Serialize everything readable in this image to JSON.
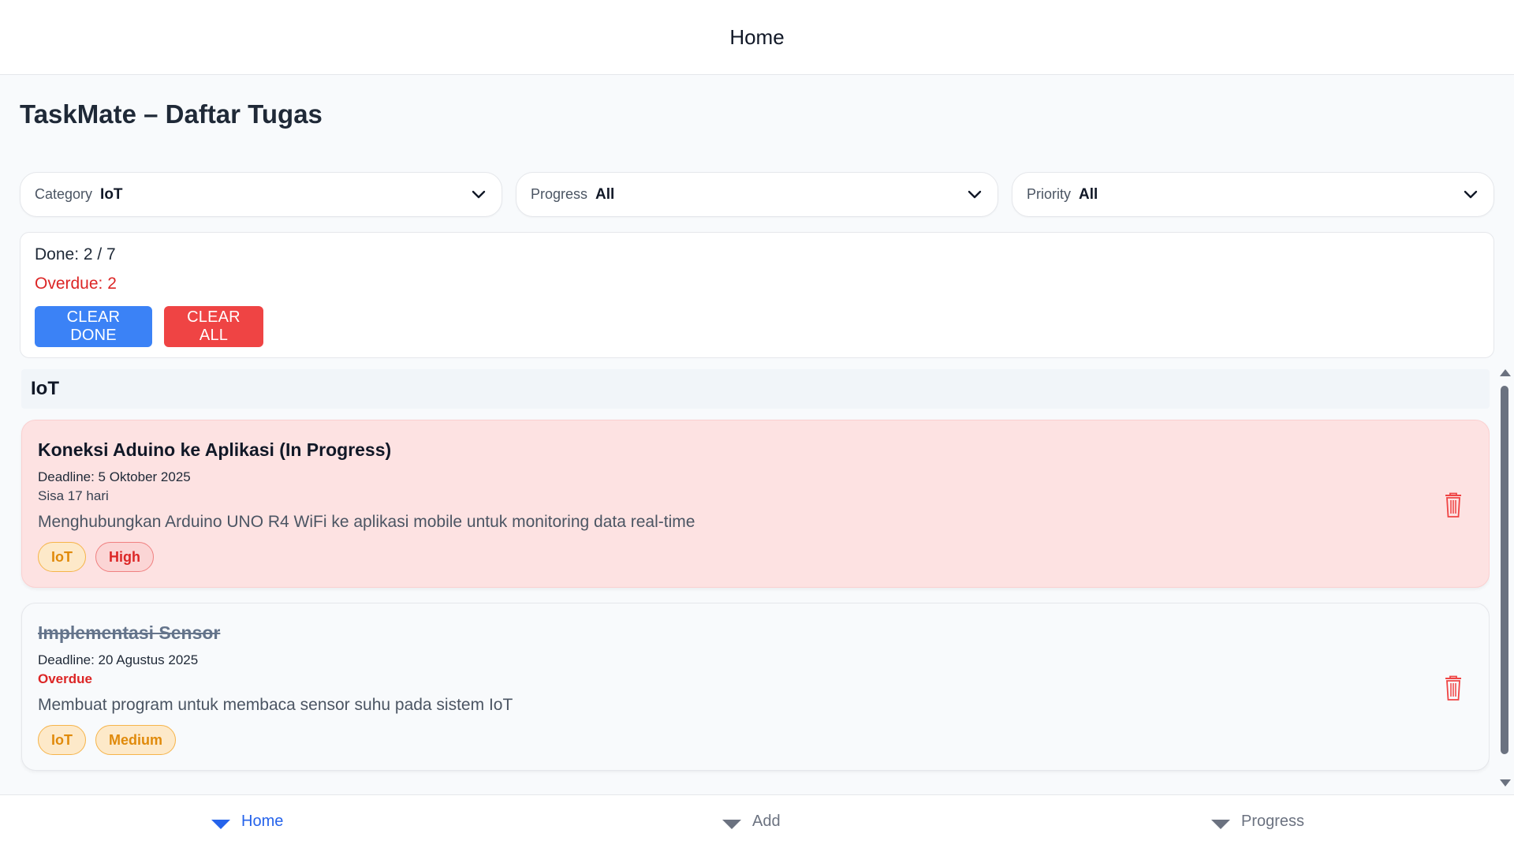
{
  "topbar": {
    "title": "Home"
  },
  "page": {
    "title": "TaskMate – Daftar Tugas"
  },
  "filters": [
    {
      "label": "Category",
      "value": "IoT",
      "icon": "chevron-down-icon"
    },
    {
      "label": "Progress",
      "value": "All",
      "icon": "chevron-down-icon"
    },
    {
      "label": "Priority",
      "value": "All",
      "icon": "chevron-down-icon"
    }
  ],
  "summary": {
    "done": "Done: 2 / 7",
    "overdue": "Overdue: 2",
    "clear_done": "CLEAR DONE",
    "clear_all": "CLEAR ALL"
  },
  "group": {
    "title": "IoT"
  },
  "tasks": [
    {
      "title": "Koneksi Aduino ke Aplikasi (In Progress)",
      "deadline": "Deadline: 5 Oktober 2025",
      "remaining": "Sisa 17 hari",
      "description": "Menghubungkan Arduino UNO R4 WiFi ke aplikasi mobile untuk monitoring data real-time",
      "category": "IoT",
      "priority": "High",
      "done": false,
      "background": "#fde2e2",
      "icon": "trash-icon"
    },
    {
      "title": "Implementasi Sensor",
      "deadline": "Deadline: 20 Agustus 2025",
      "remaining": "Overdue",
      "description": "Membuat program untuk membaca sensor suhu pada sistem IoT",
      "category": "IoT",
      "priority": "Medium",
      "done": true,
      "background": "#f8fafc",
      "icon": "trash-icon"
    }
  ],
  "nav": [
    {
      "label": "Home",
      "active": true
    },
    {
      "label": "Add",
      "active": false
    },
    {
      "label": "Progress",
      "active": false
    }
  ],
  "colors": {
    "accent": "#3b82f6",
    "danger": "#ef4444",
    "overdue_text": "#dc2626",
    "nav_active": "#2563eb"
  }
}
